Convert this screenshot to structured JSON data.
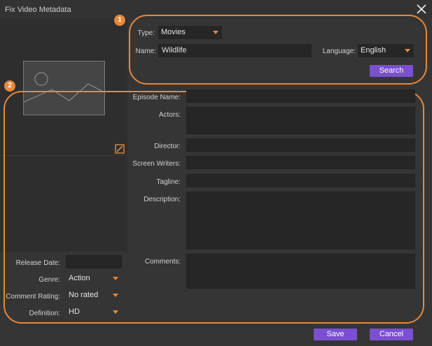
{
  "window": {
    "title": "Fix Video Metadata"
  },
  "annotations": {
    "badge_1": "1",
    "badge_2": "2"
  },
  "search_area": {
    "type_label": "Type:",
    "type_value": "Movies",
    "name_label": "Name:",
    "name_value": "Wildlife",
    "language_label": "Language:",
    "language_value": "English",
    "search_button": "Search"
  },
  "details": {
    "episode_name_label": "Episode Name:",
    "episode_name_value": "",
    "actors_label": "Actors:",
    "actors_value": "",
    "director_label": "Director:",
    "director_value": "",
    "screen_writers_label": "Screen Writers:",
    "screen_writers_value": "",
    "tagline_label": "Tagline:",
    "tagline_value": "",
    "description_label": "Description:",
    "description_value": "",
    "comments_label": "Comments:",
    "comments_value": ""
  },
  "left_fields": {
    "release_date_label": "Release Date:",
    "release_date_value": "",
    "genre_label": "Genre:",
    "genre_value": "Action",
    "comment_rating_label": "Comment Rating:",
    "comment_rating_value": "No rated",
    "definition_label": "Definition:",
    "definition_value": "HD"
  },
  "footer": {
    "save_button": "Save",
    "cancel_button": "Cancel"
  },
  "colors": {
    "accent_orange": "#e8883a",
    "button_purple": "#7b4fd1",
    "background": "#353535"
  }
}
